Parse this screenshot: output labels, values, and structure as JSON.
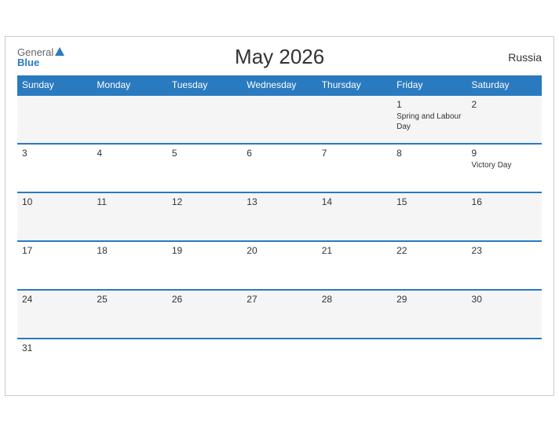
{
  "header": {
    "logo_general": "General",
    "logo_blue": "Blue",
    "title": "May 2026",
    "country": "Russia"
  },
  "days_of_week": [
    "Sunday",
    "Monday",
    "Tuesday",
    "Wednesday",
    "Thursday",
    "Friday",
    "Saturday"
  ],
  "weeks": [
    [
      {
        "num": "",
        "event": ""
      },
      {
        "num": "",
        "event": ""
      },
      {
        "num": "",
        "event": ""
      },
      {
        "num": "",
        "event": ""
      },
      {
        "num": "",
        "event": ""
      },
      {
        "num": "1",
        "event": "Spring and Labour Day"
      },
      {
        "num": "2",
        "event": ""
      }
    ],
    [
      {
        "num": "3",
        "event": ""
      },
      {
        "num": "4",
        "event": ""
      },
      {
        "num": "5",
        "event": ""
      },
      {
        "num": "6",
        "event": ""
      },
      {
        "num": "7",
        "event": ""
      },
      {
        "num": "8",
        "event": ""
      },
      {
        "num": "9",
        "event": "Victory Day"
      }
    ],
    [
      {
        "num": "10",
        "event": ""
      },
      {
        "num": "11",
        "event": ""
      },
      {
        "num": "12",
        "event": ""
      },
      {
        "num": "13",
        "event": ""
      },
      {
        "num": "14",
        "event": ""
      },
      {
        "num": "15",
        "event": ""
      },
      {
        "num": "16",
        "event": ""
      }
    ],
    [
      {
        "num": "17",
        "event": ""
      },
      {
        "num": "18",
        "event": ""
      },
      {
        "num": "19",
        "event": ""
      },
      {
        "num": "20",
        "event": ""
      },
      {
        "num": "21",
        "event": ""
      },
      {
        "num": "22",
        "event": ""
      },
      {
        "num": "23",
        "event": ""
      }
    ],
    [
      {
        "num": "24",
        "event": ""
      },
      {
        "num": "25",
        "event": ""
      },
      {
        "num": "26",
        "event": ""
      },
      {
        "num": "27",
        "event": ""
      },
      {
        "num": "28",
        "event": ""
      },
      {
        "num": "29",
        "event": ""
      },
      {
        "num": "30",
        "event": ""
      }
    ],
    [
      {
        "num": "31",
        "event": ""
      },
      {
        "num": "",
        "event": ""
      },
      {
        "num": "",
        "event": ""
      },
      {
        "num": "",
        "event": ""
      },
      {
        "num": "",
        "event": ""
      },
      {
        "num": "",
        "event": ""
      },
      {
        "num": "",
        "event": ""
      }
    ]
  ]
}
